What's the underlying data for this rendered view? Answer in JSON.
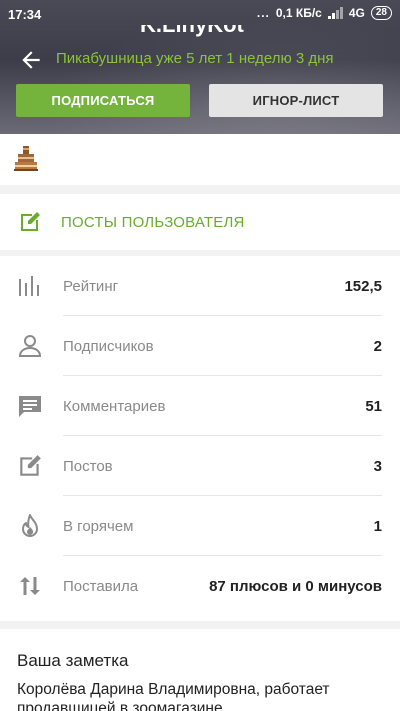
{
  "status_bar": {
    "time": "17:34",
    "dots": "...",
    "network_speed": "0,1 КБ/с",
    "network_type": "4G",
    "battery": "28"
  },
  "profile": {
    "username": "K.LinyKot",
    "tenure": "Пикабушница уже 5 лет 1 неделю 3 дня",
    "subscribe_label": "ПОДПИСАТЬСЯ",
    "ignore_label": "ИГНОР-ЛИСТ"
  },
  "posts_link": {
    "label": "ПОСТЫ ПОЛЬЗОВАТЕЛЯ"
  },
  "stats": [
    {
      "icon": "rating-bars-icon",
      "label": "Рейтинг",
      "value": "152,5"
    },
    {
      "icon": "person-icon",
      "label": "Подписчиков",
      "value": "2"
    },
    {
      "icon": "comment-icon",
      "label": "Комментариев",
      "value": "51"
    },
    {
      "icon": "edit-icon",
      "label": "Постов",
      "value": "3"
    },
    {
      "icon": "flame-icon",
      "label": "В горячем",
      "value": "1"
    },
    {
      "icon": "up-down-arrows-icon",
      "label": "Поставила",
      "value": "87 плюсов и 0 минусов"
    }
  ],
  "note": {
    "title": "Ваша заметка",
    "text": "Королёва Дарина Владимировна, работает продавщицей в зоомагазине."
  },
  "colors": {
    "accent_green": "#74b43c",
    "link_green": "#6aac2d",
    "tenure_green": "#8ac43a",
    "icon_gray": "#8a8a8a"
  }
}
